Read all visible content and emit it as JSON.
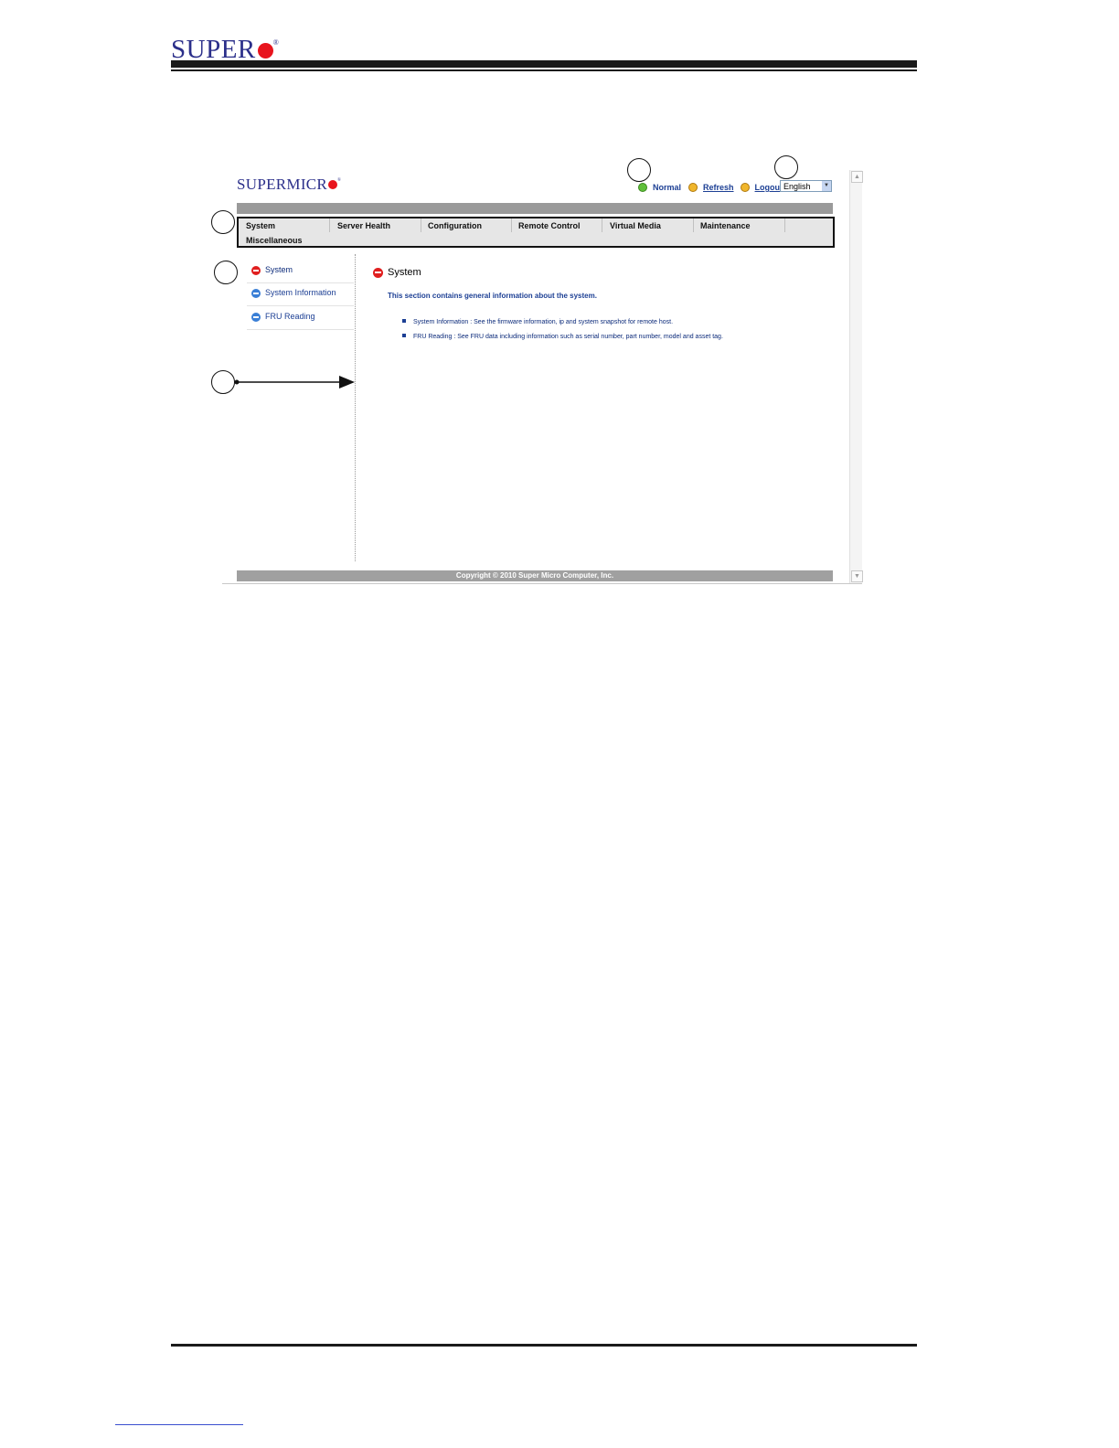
{
  "page_header": {
    "logo_text": "SUPER",
    "logo_reg": "®"
  },
  "app": {
    "logo_text": "SUPERMICR",
    "logo_reg": "®",
    "status": {
      "state": "Normal",
      "refresh": "Refresh",
      "logout": "Logout",
      "language": "English"
    },
    "menu": [
      "System",
      "Server Health",
      "Configuration",
      "Remote Control",
      "Virtual Media",
      "Maintenance",
      "Miscellaneous"
    ],
    "sidebar": [
      "System",
      "System Information",
      "FRU Reading"
    ],
    "main": {
      "title": "System",
      "description": "This section contains general information about the system.",
      "bullets": [
        "System Information : See the firmware information, ip and system snapshot for remote host.",
        "FRU Reading : See FRU data including information such as serial number, part number, model and asset tag."
      ]
    },
    "copyright": "Copyright © 2010 Super Micro Computer, Inc."
  },
  "icons": {
    "status_normal": "check-circle-icon",
    "refresh": "refresh-icon",
    "logout": "logout-icon",
    "nav_arrow": "arrow-circle-icon",
    "dropdown": "chevron-down-icon"
  },
  "colors": {
    "brand_blue": "#2b2f8a",
    "brand_red": "#e8141d",
    "link_blue": "#1c3f94"
  }
}
